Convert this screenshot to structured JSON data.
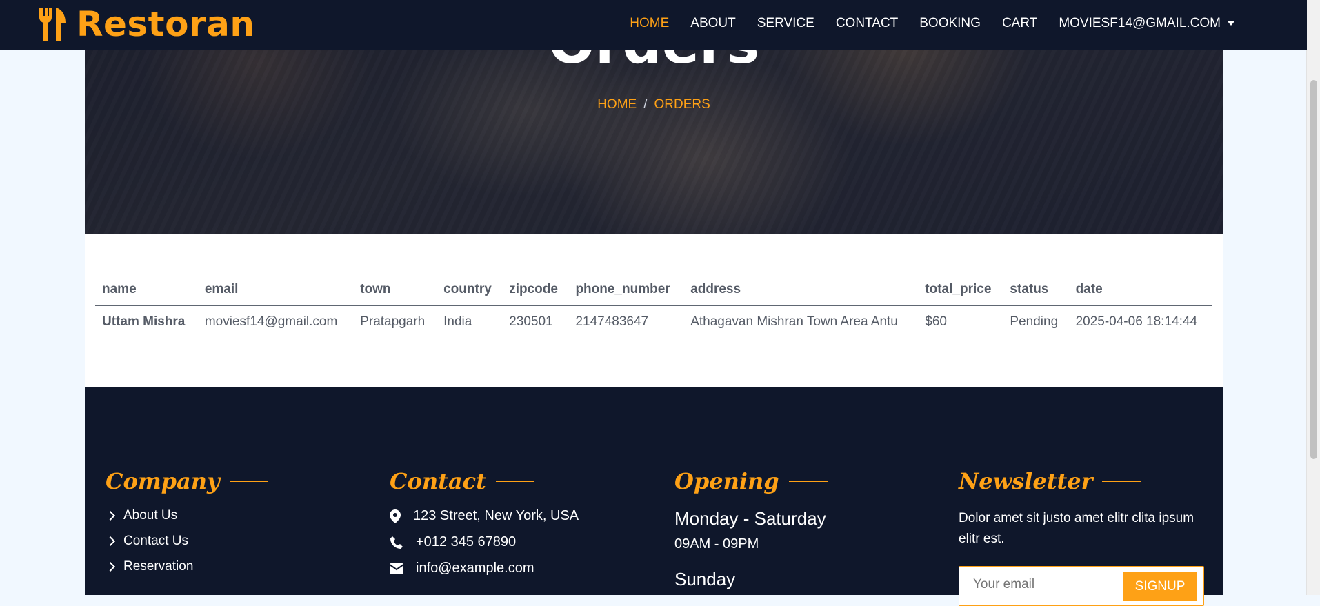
{
  "brand": {
    "name": "Restoran",
    "icon": "utensils-icon",
    "accent": "#fea116"
  },
  "nav": {
    "items": [
      {
        "label": "Home",
        "active": true
      },
      {
        "label": "About",
        "active": false
      },
      {
        "label": "Service",
        "active": false
      },
      {
        "label": "Contact",
        "active": false
      },
      {
        "label": "Booking",
        "active": false
      },
      {
        "label": "Cart",
        "active": false
      }
    ],
    "user": "moviesf14@gmail.com"
  },
  "hero": {
    "title": "Orders",
    "breadcrumb": [
      "Home",
      "Orders"
    ]
  },
  "orders_table": {
    "headers": [
      "name",
      "email",
      "town",
      "country",
      "zipcode",
      "phone_number",
      "address",
      "total_price",
      "status",
      "date"
    ],
    "rows": [
      [
        "Uttam Mishra",
        "moviesf14@gmail.com",
        "Pratapgarh",
        "India",
        "230501",
        "2147483647",
        "Athagavan Mishran Town Area Antu",
        "$60",
        "Pending",
        "2025-04-06 18:14:44"
      ]
    ]
  },
  "footer": {
    "company": {
      "title": "Company",
      "links": [
        "About Us",
        "Contact Us",
        "Reservation"
      ]
    },
    "contact": {
      "title": "Contact",
      "address": "123 Street, New York, USA",
      "phone": "+012 345 67890",
      "email": "info@example.com"
    },
    "opening": {
      "title": "Opening",
      "days1": "Monday - Saturday",
      "hours1": "09AM - 09PM",
      "days2": "Sunday"
    },
    "newsletter": {
      "title": "Newsletter",
      "text": "Dolor amet sit justo amet elitr clita ipsum elitr est.",
      "placeholder": "Your email",
      "button": "SignUp"
    }
  },
  "colors": {
    "navy": "#0f172b",
    "accent": "#fea116",
    "page_bg": "#f1f8ff"
  }
}
